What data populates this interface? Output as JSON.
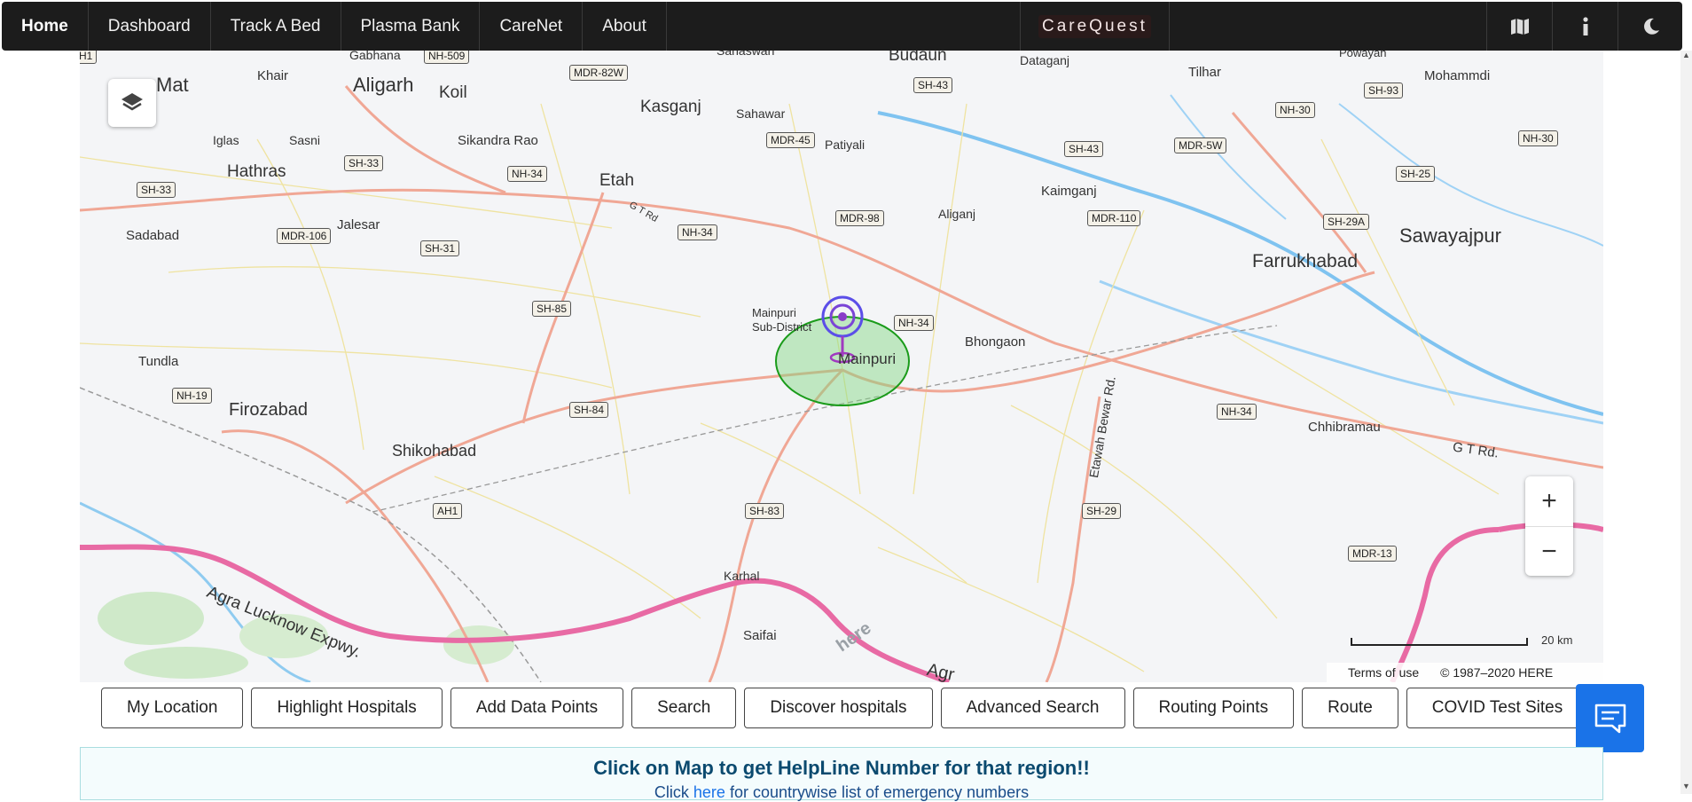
{
  "nav": {
    "items": [
      "Home",
      "Dashboard",
      "Track A Bed",
      "Plasma Bank",
      "CareNet",
      "About"
    ],
    "brand": "CareQuest",
    "icons": [
      "map-icon",
      "info-icon",
      "moon-icon"
    ]
  },
  "map": {
    "cities_large": [
      {
        "name": "Aligarh"
      },
      {
        "name": "Firozabad"
      },
      {
        "name": "Farrukhabad"
      },
      {
        "name": "Sawayajpur"
      }
    ],
    "cities_medium": [
      {
        "name": "Mat"
      },
      {
        "name": "Kasganj"
      },
      {
        "name": "Etah"
      },
      {
        "name": "Hathras"
      },
      {
        "name": "Shikohabad"
      },
      {
        "name": "Budaun"
      },
      {
        "name": "Koil"
      }
    ],
    "cities_small": [
      {
        "name": "Khair"
      },
      {
        "name": "Gabhana"
      },
      {
        "name": "Sahaswan"
      },
      {
        "name": "Dataganj"
      },
      {
        "name": "Tilhar"
      },
      {
        "name": "Powayan"
      },
      {
        "name": "Mohammdi"
      },
      {
        "name": "Sahawar"
      },
      {
        "name": "Patiyali"
      },
      {
        "name": "Iglas"
      },
      {
        "name": "Sasni"
      },
      {
        "name": "Sikandra Rao"
      },
      {
        "name": "Kaimganj"
      },
      {
        "name": "Aliganj"
      },
      {
        "name": "Sadabad"
      },
      {
        "name": "Jalesar"
      },
      {
        "name": "Bhongaon"
      },
      {
        "name": "Tundla"
      },
      {
        "name": "Chhibramau"
      },
      {
        "name": "Karhal"
      },
      {
        "name": "Saifai"
      },
      {
        "name": "Mainpuri"
      }
    ],
    "sub_district": [
      "Mainpuri",
      "Sub-District"
    ],
    "shields": [
      "NH-509",
      "MDR-82W",
      "SH-43",
      "SH-93",
      "NH-30",
      "MDR-45",
      "SH-43",
      "MDR-5W",
      "NH-30",
      "SH-33",
      "NH-34",
      "SH-33",
      "SH-25",
      "MDR-98",
      "MDR-110",
      "SH-29A",
      "MDR-106",
      "NH-34",
      "SH-31",
      "SH-85",
      "NH-34",
      "NH-19",
      "SH-84",
      "NH-34",
      "AH1",
      "SH-83",
      "SH-29",
      "MDR-13",
      "H1"
    ],
    "road_labels": [
      "Agra Lucknow Expwy.",
      "Etawah Bewar Rd.",
      "G T Rd.",
      "G T Rd",
      "Agr",
      "here"
    ],
    "marker_circle_color": "#7ed87e",
    "zoom_in": "+",
    "zoom_out": "−",
    "scale": "20 km",
    "terms": "Terms of use",
    "copyright": "© 1987–2020 HERE"
  },
  "buttons": [
    "My Location",
    "Highlight Hospitals",
    "Add Data Points",
    "Search",
    "Discover hospitals",
    "Advanced Search",
    "Routing Points",
    "Route",
    "COVID Test Sites"
  ],
  "help": {
    "title": "Click on Map to get HelpLine Number for that region!!",
    "sub_pre": "Click ",
    "sub_link": "here",
    "sub_post": " for countrywise list of emergency numbers"
  }
}
